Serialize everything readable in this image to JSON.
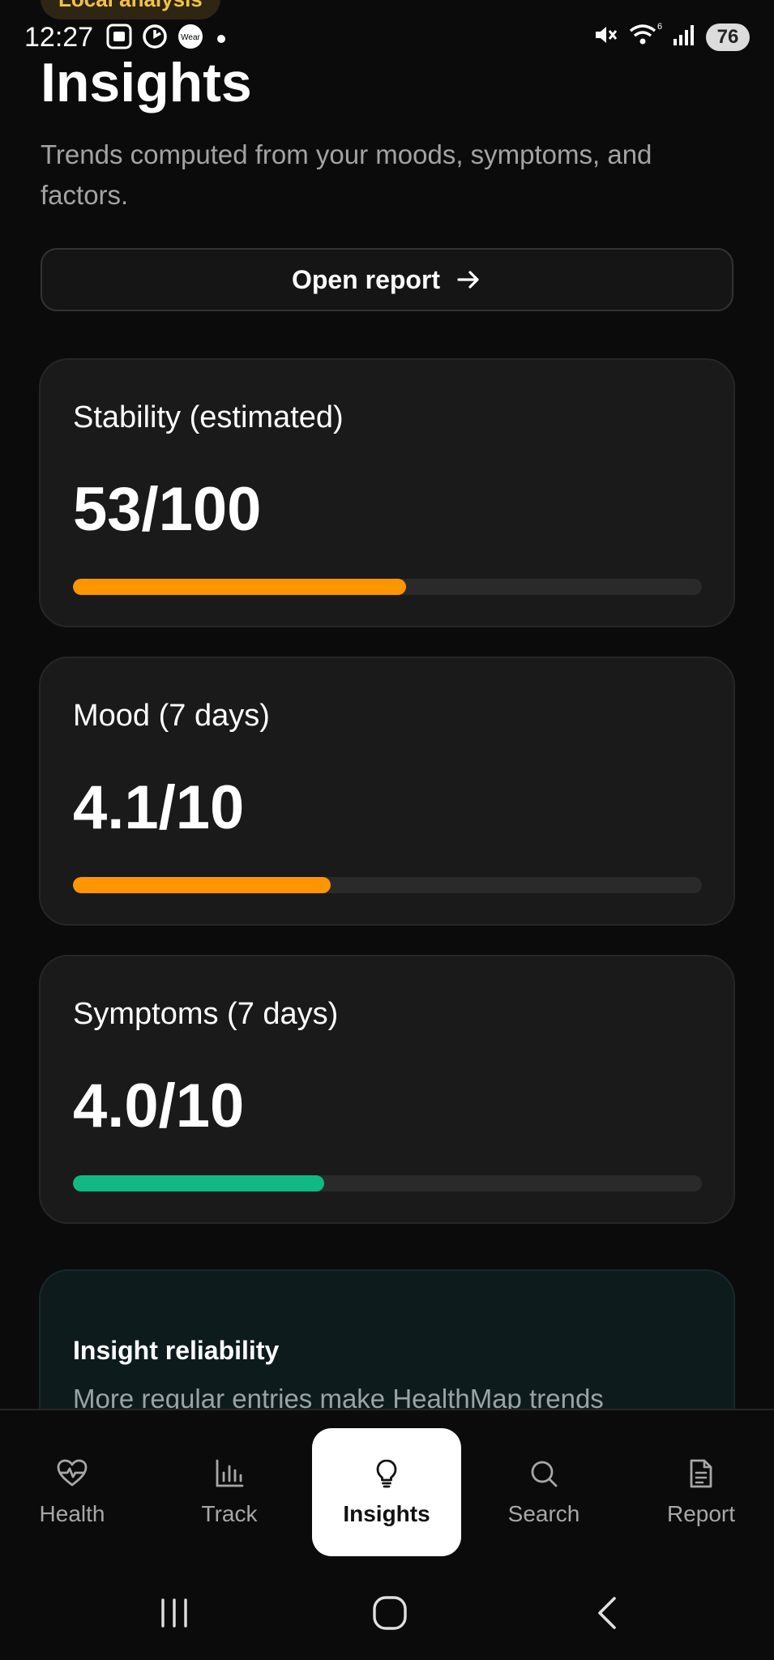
{
  "status_bar": {
    "pill": "Local analysis",
    "time": "12:27",
    "wear_label": "Wear",
    "battery": "76",
    "signal_label": "6"
  },
  "header": {
    "title": "Insights",
    "subtitle": "Trends computed from your moods, symptoms, and factors."
  },
  "open_report": {
    "label": "Open report"
  },
  "metrics": [
    {
      "label": "Stability (estimated)",
      "value": "53/100",
      "progress": 0.53,
      "color": "#ff9500"
    },
    {
      "label": "Mood (7 days)",
      "value": "4.1/10",
      "progress": 0.41,
      "color": "#ff9500"
    },
    {
      "label": "Symptoms (7 days)",
      "value": "4.0/10",
      "progress": 0.4,
      "color": "#10b981"
    }
  ],
  "reliability": {
    "title": "Insight reliability",
    "text": "More regular entries make HealthMap trends"
  },
  "nav": {
    "items": [
      {
        "label": "Health",
        "icon": "heart-pulse-icon",
        "active": false
      },
      {
        "label": "Track",
        "icon": "bar-chart-icon",
        "active": false
      },
      {
        "label": "Insights",
        "icon": "lightbulb-icon",
        "active": true
      },
      {
        "label": "Search",
        "icon": "search-icon",
        "active": false
      },
      {
        "label": "Report",
        "icon": "document-icon",
        "active": false
      }
    ]
  }
}
